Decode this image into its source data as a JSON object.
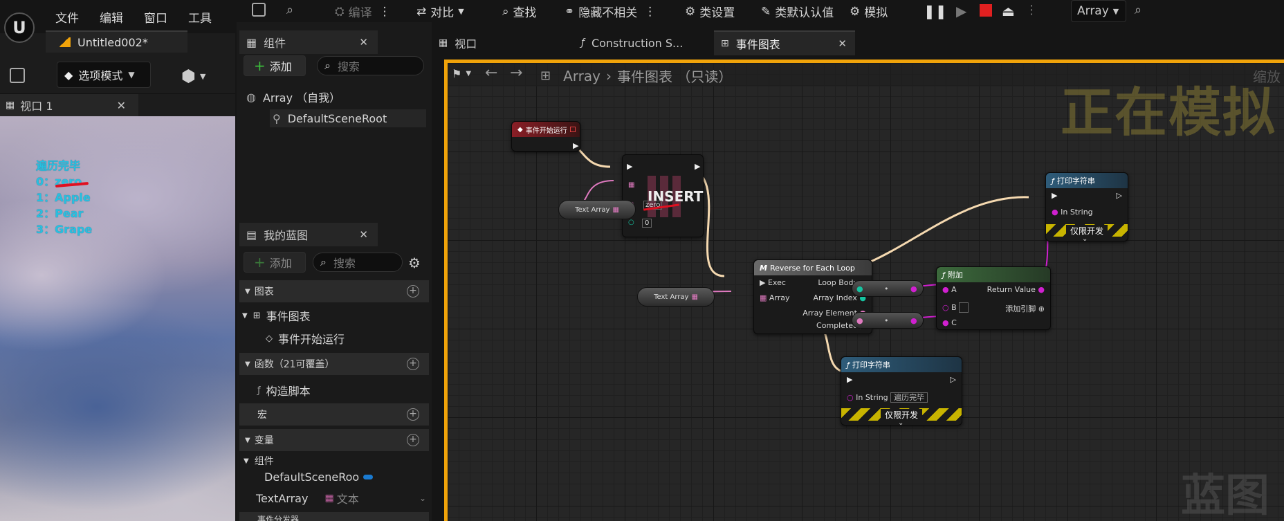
{
  "menu": {
    "items": [
      "文件",
      "编辑",
      "窗口",
      "工具"
    ]
  },
  "project_tab": {
    "title": "Untitled002*"
  },
  "left_toolbar": {
    "mode_label": "选项模式"
  },
  "viewport_panel": {
    "tab_label": "视口 1",
    "output_lines": [
      "遍历完毕",
      "0：zero",
      "1：Apple",
      "2：Pear",
      "3：Grape"
    ]
  },
  "components_panel": {
    "tab_label": "组件",
    "add_label": "添加",
    "search_placeholder": "搜索",
    "tree": [
      "Array （自我）",
      "DefaultSceneRoot"
    ]
  },
  "my_blueprint_panel": {
    "tab_label": "我的蓝图",
    "add_label": "添加",
    "search_placeholder": "搜索",
    "sections": {
      "graphs": "图表",
      "event_graph": "事件图表",
      "begin_play": "事件开始运行",
      "functions": "函数（21可覆盖）",
      "construction_script": "构造脚本",
      "macros": "宏",
      "variables": "变量",
      "components": "组件",
      "default_scene_root": "DefaultSceneRoo",
      "text_array": "TextArray",
      "text_array_type": "文本",
      "event_dispatchers": "事件分发器"
    }
  },
  "main_toolbar": {
    "compile": "编译",
    "diff": "对比",
    "find": "查找",
    "hide_unrelated": "隐藏不相关",
    "class_settings": "类设置",
    "class_defaults": "类默认认值",
    "simulate": "模拟",
    "debug_object": "Array"
  },
  "editor_tabs": [
    {
      "label": "视口"
    },
    {
      "label": "Construction S..."
    },
    {
      "label": "事件图表"
    }
  ],
  "graph": {
    "breadcrumb_root": "Array",
    "breadcrumb_graph": "事件图表 （只读）",
    "zoom_label": "缩放",
    "simulating_watermark": "正在模拟",
    "blueprint_watermark": "蓝图",
    "nodes": {
      "begin_play": {
        "title": "事件开始运行"
      },
      "insert": {
        "title": "INSERT",
        "value": "zero",
        "index": "0"
      },
      "text_array_1": {
        "label": "Text Array"
      },
      "text_array_2": {
        "label": "Text Array"
      },
      "for_each": {
        "title": "Reverse for Each Loop",
        "pins": {
          "exec": "Exec",
          "array": "Array",
          "loop_body": "Loop Body",
          "array_index": "Array Index",
          "array_element": "Array Element",
          "completed": "Completed"
        }
      },
      "append": {
        "title": "附加",
        "pins": {
          "a": "A",
          "b": "B",
          "c": "C",
          "return_value": "Return Value",
          "add_pin": "添加引脚"
        }
      },
      "print_1": {
        "title": "打印字符串",
        "in_string": "In String",
        "dev_only": "仅限开发"
      },
      "print_2": {
        "title": "打印字符串",
        "in_string": "In String",
        "in_string_value": "遍历完毕",
        "dev_only": "仅限开发"
      }
    }
  },
  "colors": {
    "accent_orange": "#f0a30a",
    "exec_wire": "#f5d9b0",
    "pink_wire": "#e07ac0",
    "magenta_pin": "#d020d0",
    "teal_pin": "#16c3a0",
    "viewport_text": "#28c0e0"
  }
}
